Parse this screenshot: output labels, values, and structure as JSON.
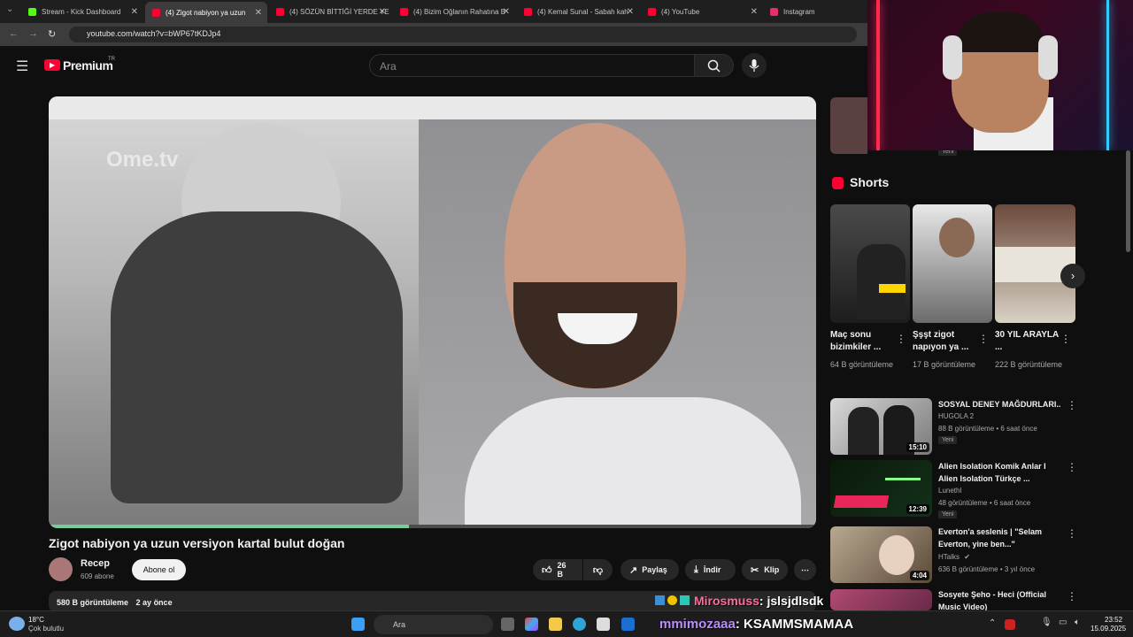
{
  "browser": {
    "tabs": [
      {
        "label": "Stream - Kick Dashboard",
        "color": "#53fc18"
      },
      {
        "label": "(4) Zigot nabiyon ya uzun",
        "color": "#ff0033"
      },
      {
        "label": "(4) SÖZÜN BİTTİĞİ YERDE YE",
        "color": "#ff0033"
      },
      {
        "label": "(4) Bizim Oğlanın Rahatına B",
        "color": "#ff0033"
      },
      {
        "label": "(4) Kemal Sunal - Sabah kah",
        "color": "#ff0033"
      },
      {
        "label": "(4) YouTube",
        "color": "#ff0033"
      },
      {
        "label": "Instagram",
        "color": "#e1306c"
      }
    ],
    "url": "youtube.com/watch?v=bWP67tKDJp4"
  },
  "youtube": {
    "logo": "Premium",
    "region": "TR",
    "search_placeholder": "Ara"
  },
  "video": {
    "overlay_brand": "Ome.tv",
    "progress_fraction": 0.47,
    "title": "Zigot nabiyon ya uzun versiyon kartal bulut doğan",
    "channel": "Recep",
    "subscribers": "609 abone",
    "subscribe_label": "Abone ol",
    "likes": "26 B",
    "share_label": "Paylaş",
    "download_label": "İndir",
    "clip_label": "Klip",
    "views": "580 B görüntüleme",
    "age": "2 ay önce"
  },
  "sidebar": {
    "top_badge": "Yeni",
    "shorts_heading": "Shorts",
    "shorts": [
      {
        "title": "Maç sonu bizimkiler ...",
        "views": "64 B görüntüleme"
      },
      {
        "title": "Şşşt zigot napıyon ya ...",
        "views": "17 B görüntüleme"
      },
      {
        "title": "30 YIL ARAYLA ...",
        "views": "222 B görüntüleme"
      }
    ],
    "recommended": [
      {
        "title": "SOSYAL DENEY MAĞDURLARI..",
        "channel": "HUGOLA 2",
        "meta": "88 B görüntüleme • 6 saat önce",
        "duration": "15:10",
        "badge": "Yeni"
      },
      {
        "title": "Alien Isolation Komik Anlar I Alien Isolation Türkçe ...",
        "channel": "Lunethl",
        "meta": "48 görüntüleme • 6 saat önce",
        "duration": "12:39",
        "badge": "Yeni"
      },
      {
        "title": "Everton'a seslenis | \"Selam Everton, yine ben...\"",
        "channel": "HTalks",
        "meta": "636 B görüntüleme • 3 yıl önce",
        "duration": "4:04",
        "badge": ""
      },
      {
        "title": "Sosyete Şeho - Heci (Official Music Video)",
        "channel": "",
        "meta": "",
        "duration": "",
        "badge": ""
      }
    ]
  },
  "chat": [
    {
      "user": "Mirosmuss",
      "message": ": jslsjdlsdk"
    },
    {
      "user": "mmimozaaa",
      "message": ": KSAMMSMAMAA"
    }
  ],
  "taskbar": {
    "temperature": "18°C",
    "weather": "Çok bulutlu",
    "search_label": "Ara",
    "time": "23:52",
    "date": "15.09.2025"
  }
}
